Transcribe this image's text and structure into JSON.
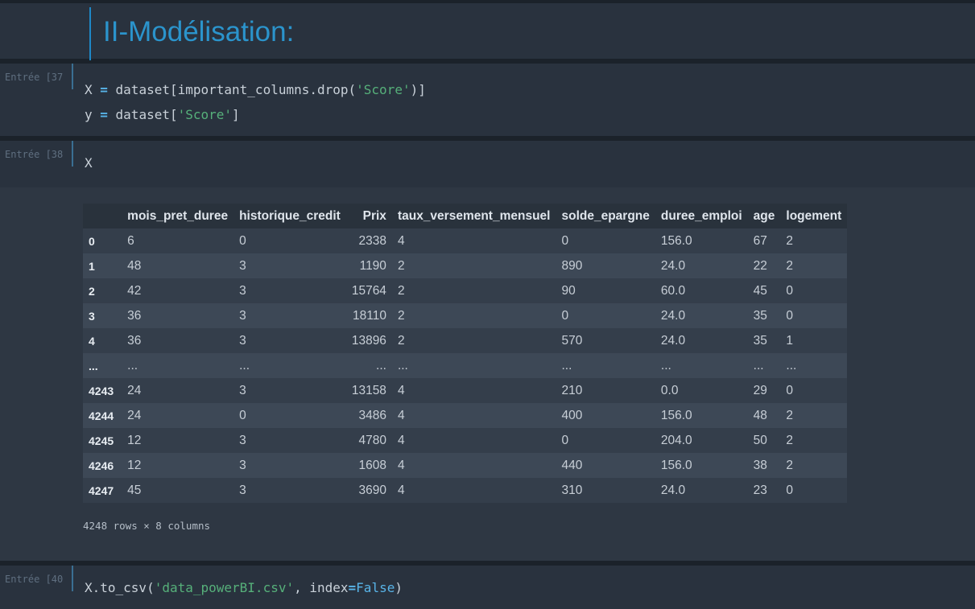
{
  "markdown": {
    "heading": "II-Modélisation:"
  },
  "cells": [
    {
      "prompt": "Entrée [37",
      "lines": [
        [
          {
            "t": "X ",
            "c": ""
          },
          {
            "t": "=",
            "c": "op"
          },
          {
            "t": " dataset[important_columns.drop(",
            "c": ""
          },
          {
            "t": "'Score'",
            "c": "str"
          },
          {
            "t": ")]",
            "c": ""
          }
        ],
        [
          {
            "t": "y ",
            "c": ""
          },
          {
            "t": "=",
            "c": "op"
          },
          {
            "t": " dataset[",
            "c": ""
          },
          {
            "t": "'Score'",
            "c": "str"
          },
          {
            "t": "]",
            "c": ""
          }
        ]
      ]
    },
    {
      "prompt": "Entrée [38",
      "lines": [
        [
          {
            "t": "X",
            "c": ""
          }
        ]
      ]
    },
    {
      "prompt": "Entrée [40",
      "lines": [
        [
          {
            "t": "X.to_csv(",
            "c": ""
          },
          {
            "t": "'data_powerBI.csv'",
            "c": "str"
          },
          {
            "t": ", index",
            "c": ""
          },
          {
            "t": "=",
            "c": "op"
          },
          {
            "t": "False",
            "c": "kw"
          },
          {
            "t": ")",
            "c": ""
          }
        ]
      ]
    }
  ],
  "dataframe": {
    "columns": [
      "mois_pret_duree",
      "historique_credit",
      "Prix",
      "taux_versement_mensuel",
      "solde_epargne",
      "duree_emploi",
      "age",
      "logement"
    ],
    "rows": [
      [
        "0",
        "6",
        "0",
        "2338",
        "4",
        "0",
        "156.0",
        "67",
        "2"
      ],
      [
        "1",
        "48",
        "3",
        "1190",
        "2",
        "890",
        "24.0",
        "22",
        "2"
      ],
      [
        "2",
        "42",
        "3",
        "15764",
        "2",
        "90",
        "60.0",
        "45",
        "0"
      ],
      [
        "3",
        "36",
        "3",
        "18110",
        "2",
        "0",
        "24.0",
        "35",
        "0"
      ],
      [
        "4",
        "36",
        "3",
        "13896",
        "2",
        "570",
        "24.0",
        "35",
        "1"
      ],
      [
        "...",
        "...",
        "...",
        "...",
        "...",
        "...",
        "...",
        "...",
        "..."
      ],
      [
        "4243",
        "24",
        "3",
        "13158",
        "4",
        "210",
        "0.0",
        "29",
        "0"
      ],
      [
        "4244",
        "24",
        "0",
        "3486",
        "4",
        "400",
        "156.0",
        "48",
        "2"
      ],
      [
        "4245",
        "12",
        "3",
        "4780",
        "4",
        "0",
        "204.0",
        "50",
        "2"
      ],
      [
        "4246",
        "12",
        "3",
        "1608",
        "4",
        "440",
        "156.0",
        "38",
        "2"
      ],
      [
        "4247",
        "45",
        "3",
        "3690",
        "4",
        "310",
        "24.0",
        "23",
        "0"
      ]
    ],
    "shape_note": "4248 rows × 8 columns"
  }
}
